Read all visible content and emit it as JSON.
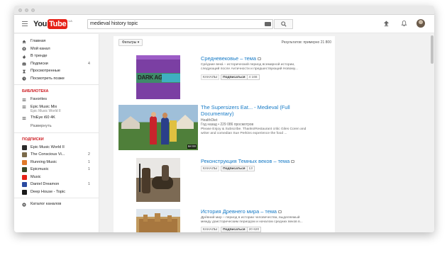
{
  "header": {
    "logo_you": "You",
    "logo_tube": "Tube",
    "logo_region": "UA",
    "search_value": "medieval history topic"
  },
  "sidebar": {
    "nav": [
      {
        "label": "Главная",
        "icon": "home-icon",
        "count": ""
      },
      {
        "label": "Мой канал",
        "icon": "user-icon",
        "count": ""
      },
      {
        "label": "В тренде",
        "icon": "flame-icon",
        "count": ""
      },
      {
        "label": "Подписки",
        "icon": "subscriptions-icon",
        "count": "4"
      },
      {
        "label": "Просмотренные",
        "icon": "hourglass-icon",
        "count": ""
      },
      {
        "label": "Посмотреть позже",
        "icon": "clock-icon",
        "count": ""
      }
    ],
    "library_heading": "БИБЛИОТЕКА",
    "library": [
      {
        "label": "Favorites",
        "sub": ""
      },
      {
        "label": "Epic Music Mix",
        "sub": "Epic Music World II"
      },
      {
        "label": "ThiEye i60 4K",
        "sub": ""
      }
    ],
    "more_label": "Развернуть",
    "subs_heading": "ПОДПИСКИ",
    "subscriptions": [
      {
        "label": "Epic Music World II",
        "count": "",
        "color": "#2b2b2b"
      },
      {
        "label": "The Conscious Vi...",
        "count": "2",
        "color": "#7a6a4a"
      },
      {
        "label": "Running Music",
        "count": "1",
        "color": "#e07a2a"
      },
      {
        "label": "Epicmusic",
        "count": "1",
        "color": "#3a4a2a"
      },
      {
        "label": "Music",
        "count": "",
        "color": "#e62117"
      },
      {
        "label": "Daniel Dreamon",
        "count": "1",
        "color": "#2a4aa0"
      },
      {
        "label": "Deep House - Topic",
        "count": "",
        "color": "#1a1a1a"
      }
    ],
    "catalog_label": "Каталог каналов"
  },
  "results": {
    "filter_label": "Фильтры",
    "count_text": "Результатов: примерно 21 800",
    "items": [
      {
        "title": "Средневековье – тема",
        "desc1": "Срéдние векá – исторический период всемирной истории,",
        "desc2": "следующий после Античности и предшествующий Новому...",
        "channel_label": "КАНАЛЫ",
        "subscribe_label": "Подписаться",
        "subscribe_count": "4 166",
        "thumb_text": "DARK AGES"
      },
      {
        "title": "The Supersizers Eat... - Medieval (Full",
        "title2": "Documentary)",
        "channel": "HealthDiet",
        "meta": "Год назад • 229 086 просмотров",
        "desc1": "Please Enjoy & Subscribe. Thanks!Restaurant critic Giles Coren and",
        "desc2": "writer and comedian Sue Perkins experience the food ...",
        "duration": "58:00"
      },
      {
        "title": "Реконструкция Темных веков – тема",
        "channel_label": "КАНАЛЫ",
        "subscribe_label": "Подписаться",
        "subscribe_count": "13"
      },
      {
        "title": "История Древнего мира – тема",
        "desc1": "Дрéвний мир – период в истории человечества, выделяемый",
        "desc2": "между доисторическим периодом и началом средних веков в...",
        "channel_label": "КАНАЛЫ",
        "subscribe_label": "Подписаться",
        "subscribe_count": "20 620"
      }
    ]
  }
}
